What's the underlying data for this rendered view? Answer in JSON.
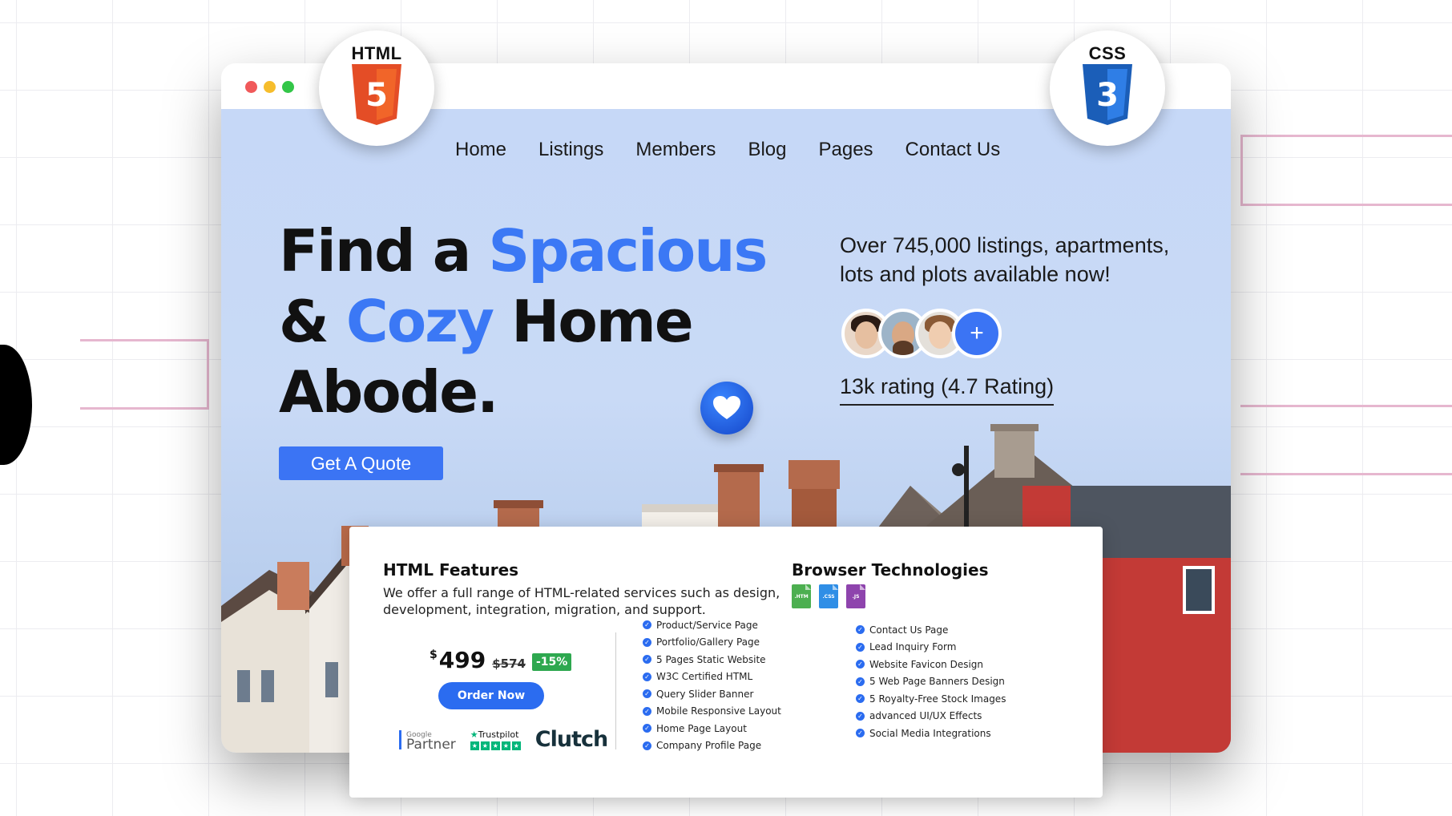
{
  "nav": [
    "Home",
    "Listings",
    "Members",
    "Blog",
    "Pages",
    "Contact Us"
  ],
  "badges": {
    "html": "HTML",
    "html_num": "5",
    "css": "CSS",
    "css_num": "3"
  },
  "hero": {
    "line1_a": "Find a ",
    "line1_b": "Spacious",
    "line2_a": "& ",
    "line2_b": "Cozy",
    "line2_c": " Home",
    "line3": "Abode.",
    "cta": "Get A Quote"
  },
  "listing_text": "Over 745,000 listings, apartments, lots and plots available now!",
  "avatar_plus": "+",
  "rating_text": "13k rating (4.7 Rating)",
  "colors": {
    "accent": "#3b78f5",
    "badge_green": "#2ea84f"
  },
  "card": {
    "title": "HTML Features",
    "description": "We offer a full range of HTML-related services such as design, development, integration, migration, and support.",
    "price": {
      "currency": "$",
      "amount": "499",
      "old": "$574",
      "discount": "-15%"
    },
    "order_button": "Order Now",
    "partners": {
      "google_small": "Google",
      "google": "Partner",
      "trustpilot": "Trustpilot",
      "clutch": "Clutch"
    },
    "tech_title": "Browser Technologies",
    "tech_files": [
      {
        "label": ".HTM",
        "color": "#4caf50"
      },
      {
        "label": ".CSS",
        "color": "#2f8ee6"
      },
      {
        "label": ".JS",
        "color": "#8e44ad"
      }
    ],
    "features_left": [
      "Product/Service Page",
      "Portfolio/Gallery Page",
      "5 Pages Static Website",
      "W3C Certified HTML",
      "Query Slider Banner",
      "Mobile Responsive Layout",
      "Home Page Layout",
      "Company Profile Page"
    ],
    "features_right": [
      "Contact Us Page",
      "Lead Inquiry Form",
      "Website Favicon Design",
      "5 Web Page Banners Design",
      "5 Royalty-Free Stock Images",
      "advanced UI/UX Effects",
      "Social Media Integrations"
    ]
  }
}
